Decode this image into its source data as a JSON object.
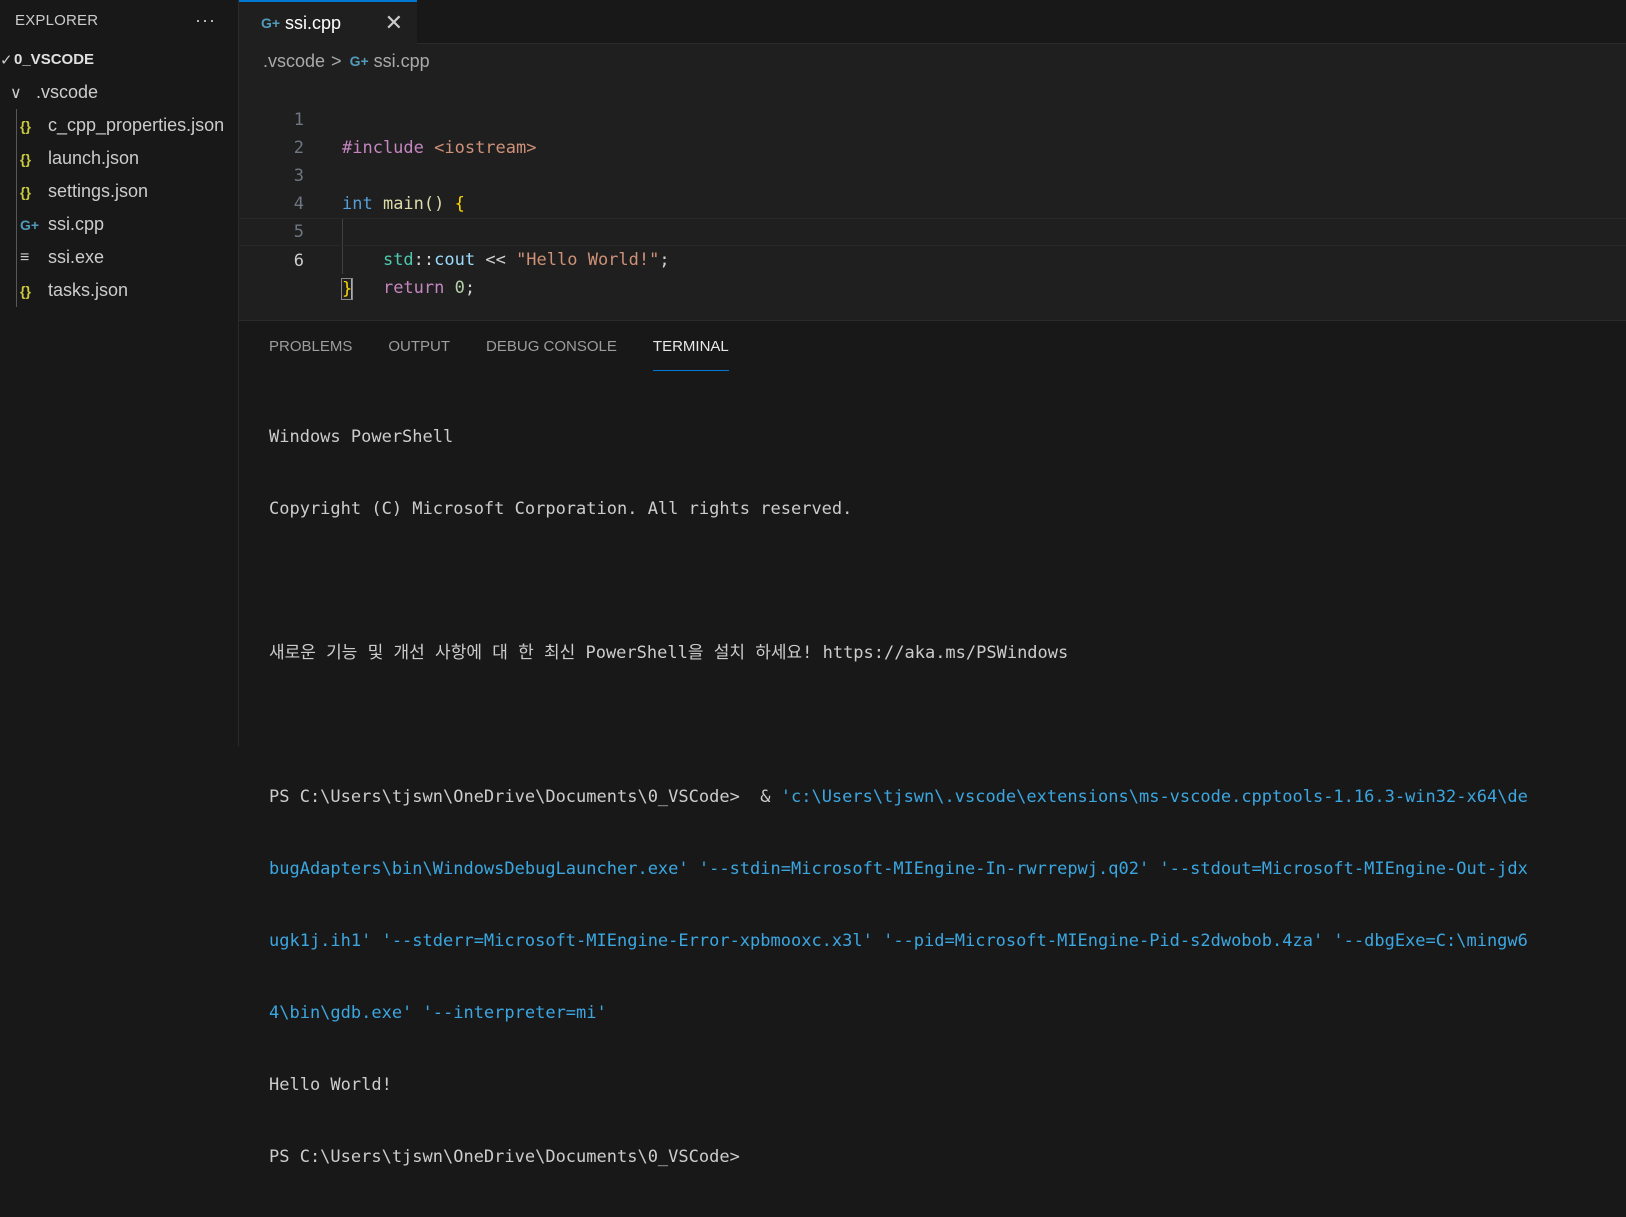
{
  "sidebar": {
    "title": "EXPLORER",
    "more_label": "···",
    "root": {
      "chevron": "✓",
      "label": "0_VSCODE"
    },
    "folder": {
      "chevron": "∨",
      "label": ".vscode"
    },
    "files": [
      {
        "icon": "{}",
        "icon_name": "json-icon",
        "label": "c_cpp_properties.json"
      },
      {
        "icon": "{}",
        "icon_name": "json-icon",
        "label": "launch.json"
      },
      {
        "icon": "{}",
        "icon_name": "json-icon",
        "label": "settings.json"
      },
      {
        "icon": "G+",
        "icon_name": "cpp-icon",
        "label": "ssi.cpp"
      },
      {
        "icon": "≡",
        "icon_name": "exe-icon",
        "label": "ssi.exe"
      },
      {
        "icon": "{}",
        "icon_name": "json-icon",
        "label": "tasks.json"
      }
    ]
  },
  "editor": {
    "tab": {
      "icon": "G+",
      "label": "ssi.cpp",
      "close": "✕"
    },
    "breadcrumb": {
      "folder": ".vscode",
      "sep": ">",
      "file_icon": "G+",
      "file": "ssi.cpp"
    },
    "line_numbers": [
      "1",
      "2",
      "3",
      "4",
      "5",
      "6"
    ],
    "tokens": {
      "l1_pp": "#include",
      "l1_inc": " <iostream>",
      "l3_type": "int",
      "l3_fn": " main",
      "l3_paren": "()",
      "l3_brace": " {",
      "l4_indent": "    ",
      "l4_ns": "std",
      "l4_scope": "::",
      "l4_var": "cout",
      "l4_op": " << ",
      "l4_str": "\"Hello World!\"",
      "l4_semi": ";",
      "l5_indent": "    ",
      "l5_ret": "return",
      "l5_num": " 0",
      "l5_semi": ";",
      "l6_brace": "}"
    }
  },
  "panel": {
    "tabs": [
      "PROBLEMS",
      "OUTPUT",
      "DEBUG CONSOLE",
      "TERMINAL"
    ],
    "active_tab": "TERMINAL",
    "terminal": {
      "line1": "Windows PowerShell",
      "line2": "Copyright (C) Microsoft Corporation. All rights reserved.",
      "line3": "새로운 기능 및 개선 사항에 대 한 최신 PowerShell을 설치 하세요! https://aka.ms/PSWindows",
      "prompt1": "PS C:\\Users\\tjswn\\OneDrive\\Documents\\0_VSCode>  & ",
      "cmd1": "'c:\\Users\\tjswn\\.vscode\\extensions\\ms-vscode.cpptools-1.16.3-win32-x64\\de",
      "cmd2": "bugAdapters\\bin\\WindowsDebugLauncher.exe' '--stdin=Microsoft-MIEngine-In-rwrrepwj.q02' '--stdout=Microsoft-MIEngine-Out-jdx",
      "cmd3": "ugk1j.ih1' '--stderr=Microsoft-MIEngine-Error-xpbmooxc.x3l' '--pid=Microsoft-MIEngine-Pid-s2dwobob.4za' '--dbgExe=C:\\mingw6",
      "cmd4": "4\\bin\\gdb.exe' '--interpreter=mi'",
      "output": "Hello World!",
      "prompt2": "PS C:\\Users\\tjswn\\OneDrive\\Documents\\0_VSCode>"
    }
  },
  "colors": {
    "accent": "#0078d4",
    "json_icon": "#cbcb41",
    "cpp_icon": "#519aba",
    "terminal_command": "#3ba7e2"
  }
}
